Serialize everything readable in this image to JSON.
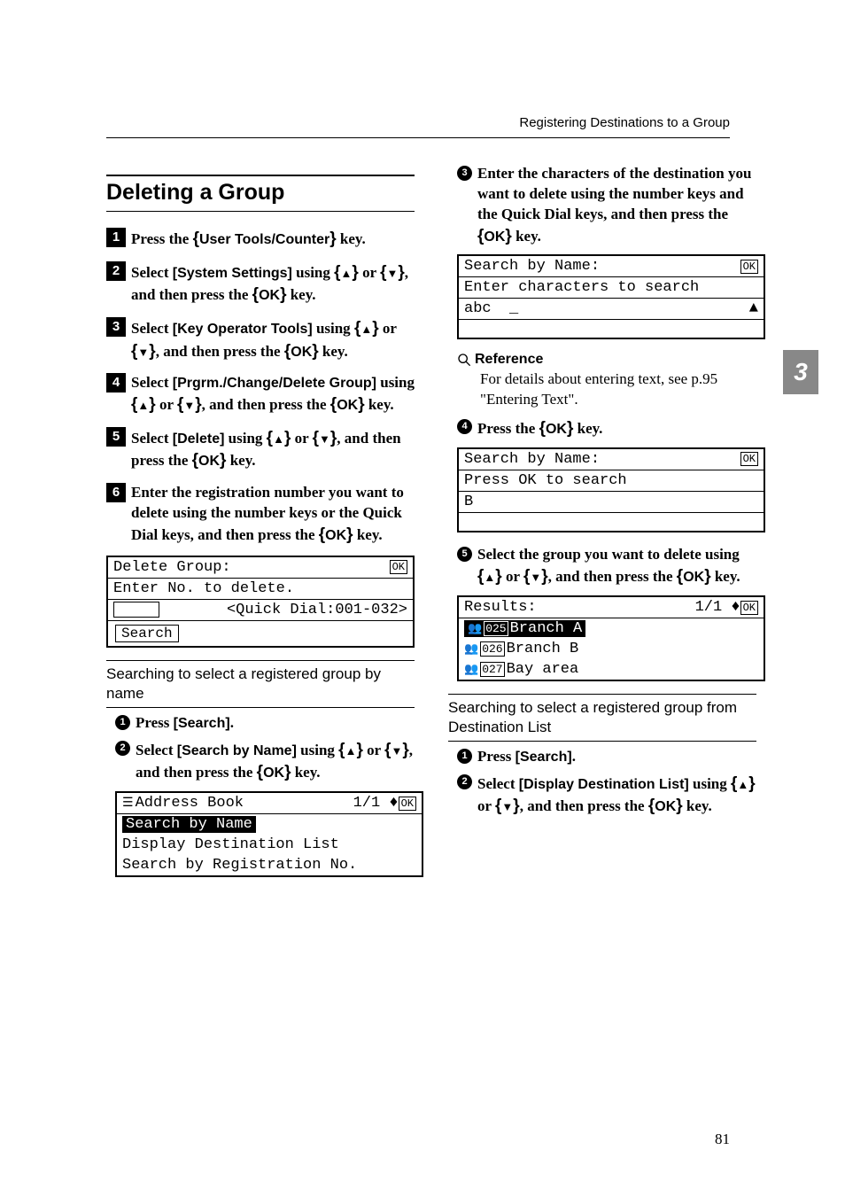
{
  "header": {
    "right_text": "Registering Destinations to a Group"
  },
  "section": {
    "title": "Deleting a Group"
  },
  "keys": {
    "user_tools": "User Tools/Counter",
    "ok": "OK"
  },
  "labels": {
    "system_settings": "[System Settings]",
    "key_operator_tools": "[Key Operator Tools]",
    "prgrm_group": "[Prgrm./Change/Delete Group]",
    "delete": "[Delete]",
    "search": "[Search]",
    "search_by_name": "[Search by Name]",
    "display_dest_list": "[Display Destination List]"
  },
  "steps": {
    "s1": "Press the ",
    "s1_tail": " key.",
    "s2a": "Select ",
    "s2b": " using ",
    "s2c": " or ",
    "s2d": ", and then press the ",
    "s2e": " key.",
    "s3a": "Select ",
    "s3b": " using ",
    "s3c": " or ",
    "s3d": ", and then press the ",
    "s3e": " key.",
    "s4a": "Select ",
    "s4b": " using ",
    "s4c": " or ",
    "s4d": ", and then press the ",
    "s4e": " key.",
    "s5a": "Select ",
    "s5b": " using ",
    "s5c": " or ",
    "s5d": ", and then press the ",
    "s5e": " key.",
    "s6a": "Enter the registration number you want to delete using the number keys or the Quick Dial keys, and then press the ",
    "s6b": " key."
  },
  "screen1": {
    "line1": "Delete Group:",
    "ok": "OK",
    "line2": "Enter No. to delete.",
    "line3": "<Quick Dial:001-032>",
    "search": "Search"
  },
  "subsection_a": {
    "title": "Searching to select a registered group by name",
    "s1": "Press ",
    "s1_tail": ".",
    "s2a": "Select ",
    "s2b": " using ",
    "s2c": " or ",
    "s2d": ", and then press the ",
    "s2e": " key."
  },
  "screen2": {
    "title": "Address Book",
    "pager": "1/1",
    "ok": "OK",
    "row1": "Search by Name",
    "row2": "Display Destination List",
    "row3": "Search by Registration No."
  },
  "col2": {
    "s3a": "Enter the characters of the destination you want to delete using the number keys and the Quick Dial keys, and then press the ",
    "s3b": " key."
  },
  "screen3": {
    "line1": "Search by Name:",
    "ok": "OK",
    "line2": "Enter characters to search",
    "mode": "abc",
    "val": "_",
    "shift": "▲"
  },
  "reference": {
    "heading": "Reference",
    "body": "For details about entering text, see p.95 \"Entering Text\"."
  },
  "s4": {
    "text": "Press the ",
    "tail": " key."
  },
  "screen4": {
    "line1": "Search by Name:",
    "ok": "OK",
    "line2": "Press OK to search",
    "val": "B"
  },
  "s5": {
    "a": "Select the group you want to delete using ",
    "b": " or ",
    "c": ", and then press the ",
    "d": " key."
  },
  "screen5": {
    "title": "Results:",
    "pager": "1/1",
    "ok": "OK",
    "r1_id": "025",
    "r1_name": "Branch A",
    "r2_id": "026",
    "r2_name": "Branch B",
    "r3_id": "027",
    "r3_name": "Bay area"
  },
  "subsection_b": {
    "title": "Searching to select a registered group from Destination List",
    "s1": "Press ",
    "s1_tail": ".",
    "s2a": "Select ",
    "s2b": " using ",
    "s2c": " or ",
    "s2d": ", and then press the ",
    "s2e": " key."
  },
  "tab_number": "3",
  "page_number": "81"
}
